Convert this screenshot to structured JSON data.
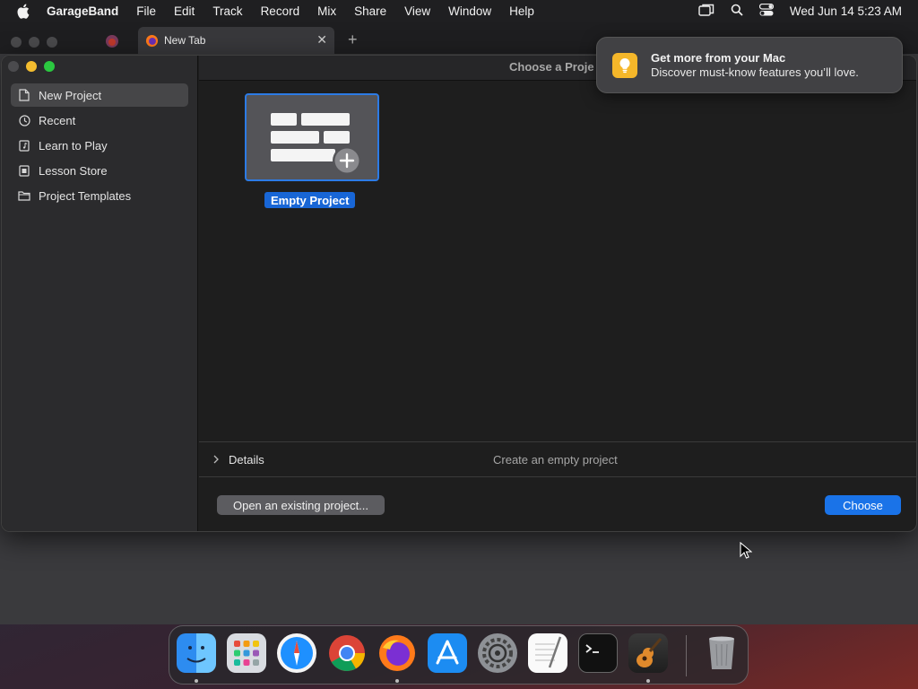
{
  "menubar": {
    "app_name": "GarageBand",
    "items": [
      "File",
      "Edit",
      "Track",
      "Record",
      "Mix",
      "Share",
      "View",
      "Window",
      "Help"
    ],
    "clock": "Wed Jun 14  5:23 AM"
  },
  "browser": {
    "tab_title": "New Tab"
  },
  "window": {
    "title": "Choose a Proje",
    "sidebar": [
      {
        "label": "New Project",
        "icon": "document-icon",
        "selected": true
      },
      {
        "label": "Recent",
        "icon": "clock-icon",
        "selected": false
      },
      {
        "label": "Learn to Play",
        "icon": "music-book-icon",
        "selected": false
      },
      {
        "label": "Lesson Store",
        "icon": "store-icon",
        "selected": false
      },
      {
        "label": "Project Templates",
        "icon": "folder-icon",
        "selected": false
      }
    ],
    "project_tile": {
      "label": "Empty Project"
    },
    "details": {
      "label": "Details",
      "description": "Create an empty project"
    },
    "buttons": {
      "open_existing": "Open an existing project...",
      "choose": "Choose"
    }
  },
  "notification": {
    "title": "Get more from your Mac",
    "body": "Discover must-know features you’ll love."
  },
  "dock": [
    {
      "name": "Finder",
      "running": true
    },
    {
      "name": "Launchpad",
      "running": false
    },
    {
      "name": "Safari",
      "running": false
    },
    {
      "name": "Chrome",
      "running": false
    },
    {
      "name": "Firefox",
      "running": true
    },
    {
      "name": "App Store",
      "running": false
    },
    {
      "name": "System Preferences",
      "running": false
    },
    {
      "name": "TextEdit",
      "running": false
    },
    {
      "name": "Terminal",
      "running": false
    },
    {
      "name": "GarageBand",
      "running": true
    },
    {
      "name": "Trash",
      "running": false
    }
  ],
  "colors": {
    "accent": "#1a73e8",
    "selection": "#464648",
    "tile_border": "#2c7be5",
    "notif_icon": "#f5b72a"
  }
}
